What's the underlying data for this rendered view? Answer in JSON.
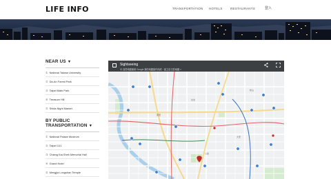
{
  "header": {
    "logo": "LIFE INFO",
    "nav": [
      "TRANSPORTATION",
      "HOTELS",
      "RESTAURANTS"
    ],
    "login": "登入"
  },
  "sidebar": {
    "near_heading": "NEAR US",
    "near_items": [
      {
        "num": "①",
        "label": "National Taiwan University"
      },
      {
        "num": "②",
        "label": "Da-An Forest Park"
      },
      {
        "num": "③",
        "label": "Taipei Main Park"
      },
      {
        "num": "④",
        "label": "Treasure Hill"
      },
      {
        "num": "⑤",
        "label": "Shida Night Market"
      }
    ],
    "transport_heading_1": "BY PUBLIC",
    "transport_heading_2": "TRANSPORTATION",
    "transport_items": [
      {
        "num": "①",
        "label": "National Palace Museum"
      },
      {
        "num": "②",
        "label": "Taipei 101"
      },
      {
        "num": "③",
        "label": "Chiang Kai-Shek Memorial Hall"
      },
      {
        "num": "④",
        "label": "Grand Hotel"
      },
      {
        "num": "⑤",
        "label": "Mengjia Longshan Temple"
      }
    ],
    "triangle": "▼"
  },
  "map": {
    "title": "Sightseeing",
    "subtitle": "⊕ 這些地圖使用 Google 我的地圖製作而成・建立自己的地圖 »",
    "share_icon": "share-icon",
    "fullscreen_icon": "fullscreen-icon"
  },
  "colors": {
    "header_bg": "#ffffff",
    "map_bar": "#3c4043",
    "marker_blue": "#3f7fd1",
    "marker_red": "#c62828"
  }
}
